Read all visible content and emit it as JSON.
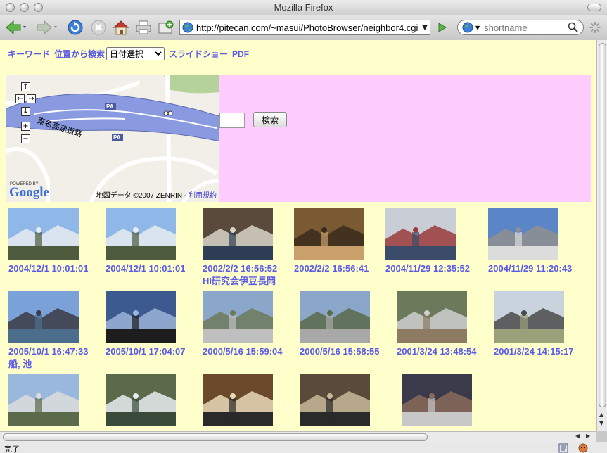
{
  "window": {
    "title": "Mozilla Firefox"
  },
  "toolbar": {
    "url": "http://pitecan.com/~masui/PhotoBrowser/neighbor4.cgi",
    "search_placeholder": "shortname"
  },
  "nav": {
    "keyword": "キーワード",
    "location_search": "位置から検索",
    "date_select": "日付選択",
    "slideshow": "スライドショー",
    "pdf": "PDF"
  },
  "map": {
    "highway_label": "東名高速道路",
    "pa_label": "PA",
    "powered_by": "POWERED BY",
    "google_logo": "Google",
    "credit": "地図データ ©2007 ZENRIN -",
    "terms": "利用規約",
    "controls": {
      "up": "↑",
      "left": "←",
      "right": "→",
      "down": "↓",
      "zoom_in": "+",
      "zoom_out": "−"
    }
  },
  "search": {
    "button_label": "検索"
  },
  "photos": [
    {
      "caption": "2004/12/1 10:01:01",
      "note": "",
      "colors": [
        "#8fb7e8",
        "#e6ecef",
        "#4f5b3e"
      ],
      "icon": "mountain-photo-icon"
    },
    {
      "caption": "2004/12/1 10:01:01",
      "note": "",
      "colors": [
        "#8fb7e8",
        "#e6ecef",
        "#4f5b3e"
      ],
      "icon": "mountain-photo-icon"
    },
    {
      "caption": "2002/2/2 16:56:52",
      "note": "HI研究会伊豆長岡",
      "colors": [
        "#5a4a3c",
        "#d8d2c8",
        "#2e3d55"
      ],
      "icon": "meeting-photo-icon"
    },
    {
      "caption": "2002/2/2 16:56:41",
      "note": "",
      "colors": [
        "#7a5a32",
        "#3b2b1e",
        "#c9a06b"
      ],
      "icon": "portrait-photo-icon"
    },
    {
      "caption": "2004/11/29 12:35:52",
      "note": "",
      "colors": [
        "#c9ced6",
        "#9a3b3b",
        "#3b4b6a"
      ],
      "icon": "window-photo-icon"
    },
    {
      "caption": "2004/11/29 11:20:43",
      "note": "",
      "colors": [
        "#5a86c8",
        "#8f8f8f",
        "#dcdcdc"
      ],
      "icon": "parking-photo-icon"
    },
    {
      "caption": "2005/10/1 16:47:33",
      "note": "船, 池",
      "colors": [
        "#7aa2d8",
        "#3b3b44",
        "#4d6d8d"
      ],
      "icon": "ship-photo-icon"
    },
    {
      "caption": "2005/10/1 17:04:07",
      "note": "",
      "colors": [
        "#3d5a90",
        "#9ab4d8",
        "#1d1d1d"
      ],
      "icon": "sunset-photo-icon"
    },
    {
      "caption": "2000/5/16 15:59:04",
      "note": "",
      "colors": [
        "#8aa6c8",
        "#6d7a5a",
        "#bfbfbf"
      ],
      "icon": "lake-photo-icon"
    },
    {
      "caption": "2000/5/16 15:58:55",
      "note": "",
      "colors": [
        "#8aa6c8",
        "#5a6a4a",
        "#a8a8a8"
      ],
      "icon": "lake-photo-icon"
    },
    {
      "caption": "2001/3/24 13:48:54",
      "note": "",
      "colors": [
        "#6a7a5a",
        "#cfcfcf",
        "#8c7a62"
      ],
      "icon": "ruins-photo-icon"
    },
    {
      "caption": "2001/3/24 14:15:17",
      "note": "",
      "colors": [
        "#c9d3de",
        "#4a4a4a",
        "#9aa07a"
      ],
      "icon": "couple-photo-icon"
    },
    {
      "caption": "",
      "note": "",
      "colors": [
        "#9ab8de",
        "#dcdcdc",
        "#5a6a4a"
      ],
      "icon": "hotel-photo-icon"
    },
    {
      "caption": "",
      "note": "",
      "colors": [
        "#5a6a4a",
        "#e8ecef",
        "#3a4a3a"
      ],
      "icon": "snowy-forest-photo-icon"
    },
    {
      "caption": "",
      "note": "",
      "colors": [
        "#6a4a2a",
        "#e8d8b8",
        "#2a2a2a"
      ],
      "icon": "presentation-photo-icon"
    },
    {
      "caption": "",
      "note": "",
      "colors": [
        "#5a4a3a",
        "#c8b89a",
        "#2a2a2a"
      ],
      "icon": "banquet-photo-icon"
    },
    {
      "caption": "",
      "note": "",
      "colors": [
        "#3a3a4a",
        "#8a6a5a",
        "#c8c8c8"
      ],
      "icon": "group-photo-icon"
    }
  ],
  "status": {
    "text": "完了"
  }
}
